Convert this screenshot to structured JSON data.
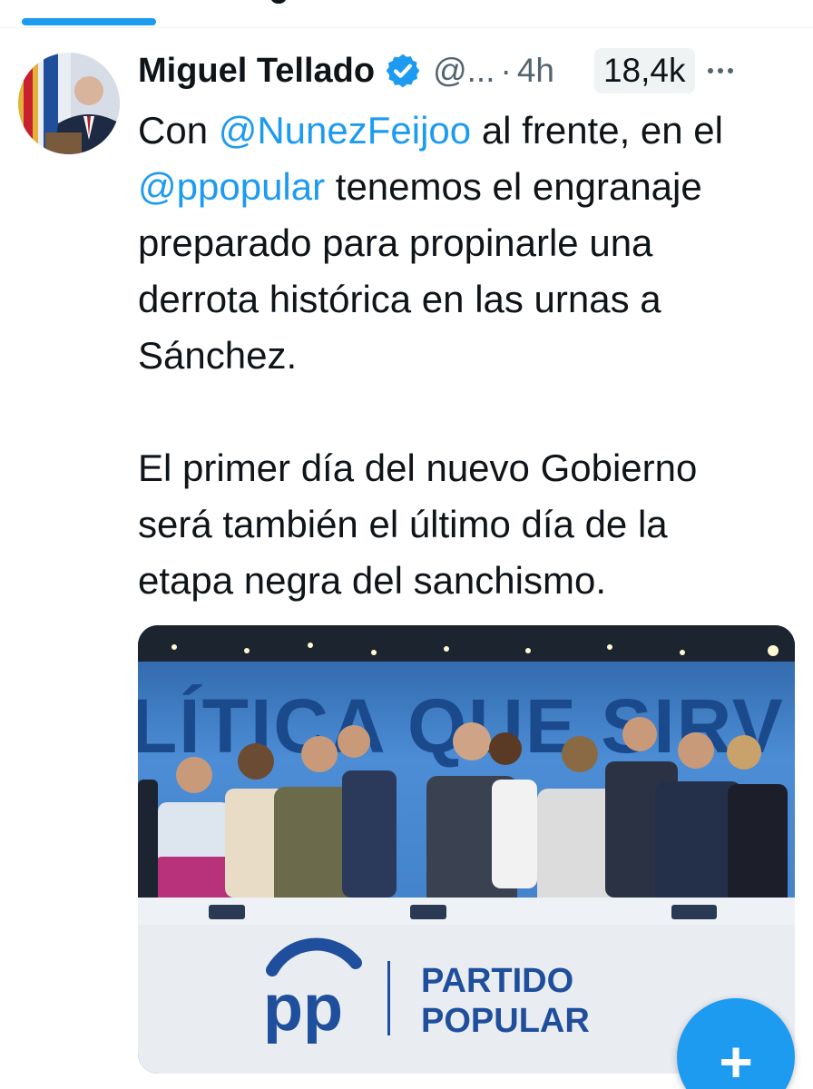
{
  "tweet": {
    "author_name": "Miguel Tellado",
    "handle": "@...",
    "separator": "·",
    "timestamp": "4h",
    "views": "18,4k",
    "text": {
      "m1": "@NunezFeijoo",
      "line1_rest": " al frente, en el",
      "m2": "@ppopular",
      "line2_rest": " tenemos el engranaje\npreparado para propinarle una\nderrota histórica en las urnas a\nSánchez.",
      "paragraph2": "El primer día del nuevo Gobierno\nserá también el último día de la\netapa negra del sanchismo."
    }
  },
  "media": {
    "slogan": "LÍTICA QUE SIRV",
    "logo_mark": "pp",
    "logo_line1": "PARTIDO",
    "logo_line2": "POPULAR"
  },
  "fab": {
    "label": "+"
  },
  "colors": {
    "accent": "#1d9bf0",
    "text": "#0f1419",
    "muted": "#536471",
    "badge_bg": "#eff3f4",
    "pp_blue": "#1f4f9c"
  },
  "icons": [
    "verified-badge-icon",
    "more-options-icon",
    "compose-plus-icon"
  ]
}
